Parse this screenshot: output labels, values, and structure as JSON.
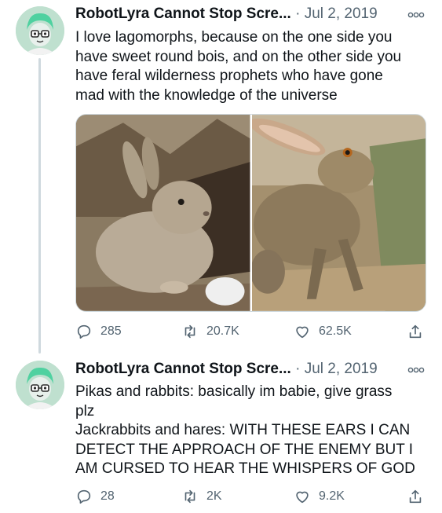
{
  "tweets": [
    {
      "author": "RobotLyra Cannot Stop Scre...",
      "separator": "·",
      "date": "Jul 2, 2019",
      "text": "I love lagomorphs, because on the one side you\nhave sweet round bois, and on the other side you\nhave feral wilderness prophets who have gone\nmad with the knowledge of the universe",
      "images": [
        "pika-photo",
        "jackrabbit-photo"
      ],
      "replies": "285",
      "retweets": "20.7K",
      "likes": "62.5K"
    },
    {
      "author": "RobotLyra Cannot Stop Scre...",
      "separator": "·",
      "date": "Jul 2, 2019",
      "text": "Pikas and rabbits: basically im babie, give grass\nplz\nJackrabbits and hares: WITH THESE EARS I CAN\nDETECT THE APPROACH OF THE ENEMY BUT I\nAM CURSED TO HEAR THE WHISPERS OF GOD",
      "replies": "28",
      "retweets": "2K",
      "likes": "9.2K"
    }
  ],
  "icons": {
    "reply": "reply-icon",
    "retweet": "retweet-icon",
    "like": "heart-icon",
    "share": "share-icon",
    "more": "more-icon"
  },
  "colors": {
    "text": "#0f1419",
    "muted": "#536471",
    "thread_line": "#cfd9de",
    "avatar_bg": "#bfe0cf"
  }
}
